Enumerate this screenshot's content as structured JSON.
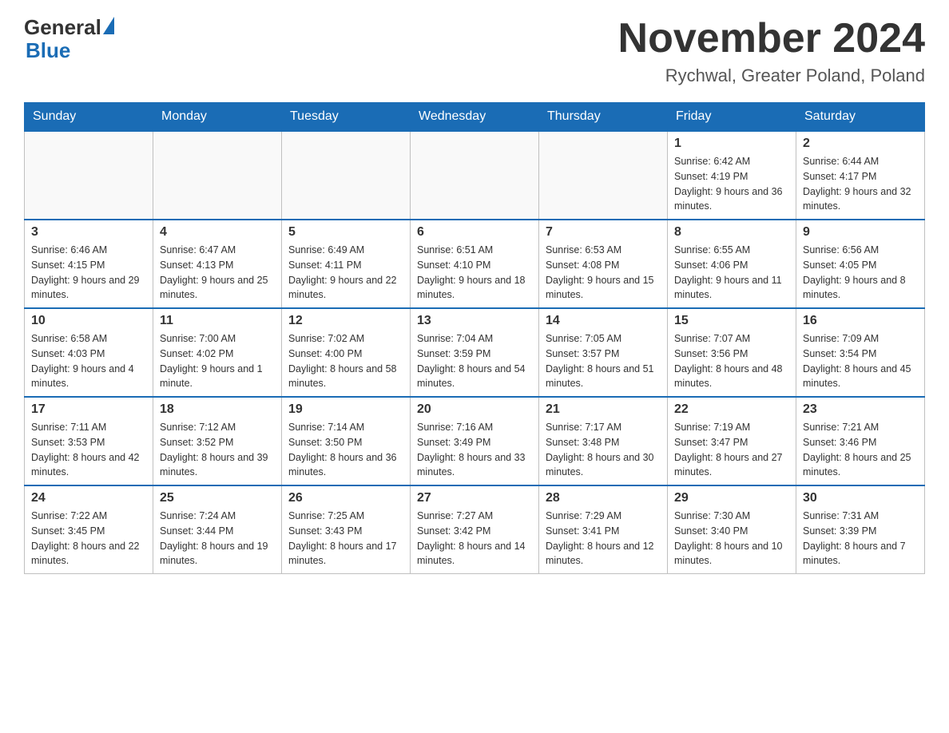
{
  "header": {
    "logo_text_general": "General",
    "logo_text_blue": "Blue",
    "title": "November 2024",
    "subtitle": "Rychwal, Greater Poland, Poland"
  },
  "weekdays": [
    "Sunday",
    "Monday",
    "Tuesday",
    "Wednesday",
    "Thursday",
    "Friday",
    "Saturday"
  ],
  "weeks": [
    [
      {
        "day": "",
        "info": ""
      },
      {
        "day": "",
        "info": ""
      },
      {
        "day": "",
        "info": ""
      },
      {
        "day": "",
        "info": ""
      },
      {
        "day": "",
        "info": ""
      },
      {
        "day": "1",
        "info": "Sunrise: 6:42 AM\nSunset: 4:19 PM\nDaylight: 9 hours and 36 minutes."
      },
      {
        "day": "2",
        "info": "Sunrise: 6:44 AM\nSunset: 4:17 PM\nDaylight: 9 hours and 32 minutes."
      }
    ],
    [
      {
        "day": "3",
        "info": "Sunrise: 6:46 AM\nSunset: 4:15 PM\nDaylight: 9 hours and 29 minutes."
      },
      {
        "day": "4",
        "info": "Sunrise: 6:47 AM\nSunset: 4:13 PM\nDaylight: 9 hours and 25 minutes."
      },
      {
        "day": "5",
        "info": "Sunrise: 6:49 AM\nSunset: 4:11 PM\nDaylight: 9 hours and 22 minutes."
      },
      {
        "day": "6",
        "info": "Sunrise: 6:51 AM\nSunset: 4:10 PM\nDaylight: 9 hours and 18 minutes."
      },
      {
        "day": "7",
        "info": "Sunrise: 6:53 AM\nSunset: 4:08 PM\nDaylight: 9 hours and 15 minutes."
      },
      {
        "day": "8",
        "info": "Sunrise: 6:55 AM\nSunset: 4:06 PM\nDaylight: 9 hours and 11 minutes."
      },
      {
        "day": "9",
        "info": "Sunrise: 6:56 AM\nSunset: 4:05 PM\nDaylight: 9 hours and 8 minutes."
      }
    ],
    [
      {
        "day": "10",
        "info": "Sunrise: 6:58 AM\nSunset: 4:03 PM\nDaylight: 9 hours and 4 minutes."
      },
      {
        "day": "11",
        "info": "Sunrise: 7:00 AM\nSunset: 4:02 PM\nDaylight: 9 hours and 1 minute."
      },
      {
        "day": "12",
        "info": "Sunrise: 7:02 AM\nSunset: 4:00 PM\nDaylight: 8 hours and 58 minutes."
      },
      {
        "day": "13",
        "info": "Sunrise: 7:04 AM\nSunset: 3:59 PM\nDaylight: 8 hours and 54 minutes."
      },
      {
        "day": "14",
        "info": "Sunrise: 7:05 AM\nSunset: 3:57 PM\nDaylight: 8 hours and 51 minutes."
      },
      {
        "day": "15",
        "info": "Sunrise: 7:07 AM\nSunset: 3:56 PM\nDaylight: 8 hours and 48 minutes."
      },
      {
        "day": "16",
        "info": "Sunrise: 7:09 AM\nSunset: 3:54 PM\nDaylight: 8 hours and 45 minutes."
      }
    ],
    [
      {
        "day": "17",
        "info": "Sunrise: 7:11 AM\nSunset: 3:53 PM\nDaylight: 8 hours and 42 minutes."
      },
      {
        "day": "18",
        "info": "Sunrise: 7:12 AM\nSunset: 3:52 PM\nDaylight: 8 hours and 39 minutes."
      },
      {
        "day": "19",
        "info": "Sunrise: 7:14 AM\nSunset: 3:50 PM\nDaylight: 8 hours and 36 minutes."
      },
      {
        "day": "20",
        "info": "Sunrise: 7:16 AM\nSunset: 3:49 PM\nDaylight: 8 hours and 33 minutes."
      },
      {
        "day": "21",
        "info": "Sunrise: 7:17 AM\nSunset: 3:48 PM\nDaylight: 8 hours and 30 minutes."
      },
      {
        "day": "22",
        "info": "Sunrise: 7:19 AM\nSunset: 3:47 PM\nDaylight: 8 hours and 27 minutes."
      },
      {
        "day": "23",
        "info": "Sunrise: 7:21 AM\nSunset: 3:46 PM\nDaylight: 8 hours and 25 minutes."
      }
    ],
    [
      {
        "day": "24",
        "info": "Sunrise: 7:22 AM\nSunset: 3:45 PM\nDaylight: 8 hours and 22 minutes."
      },
      {
        "day": "25",
        "info": "Sunrise: 7:24 AM\nSunset: 3:44 PM\nDaylight: 8 hours and 19 minutes."
      },
      {
        "day": "26",
        "info": "Sunrise: 7:25 AM\nSunset: 3:43 PM\nDaylight: 8 hours and 17 minutes."
      },
      {
        "day": "27",
        "info": "Sunrise: 7:27 AM\nSunset: 3:42 PM\nDaylight: 8 hours and 14 minutes."
      },
      {
        "day": "28",
        "info": "Sunrise: 7:29 AM\nSunset: 3:41 PM\nDaylight: 8 hours and 12 minutes."
      },
      {
        "day": "29",
        "info": "Sunrise: 7:30 AM\nSunset: 3:40 PM\nDaylight: 8 hours and 10 minutes."
      },
      {
        "day": "30",
        "info": "Sunrise: 7:31 AM\nSunset: 3:39 PM\nDaylight: 8 hours and 7 minutes."
      }
    ]
  ]
}
